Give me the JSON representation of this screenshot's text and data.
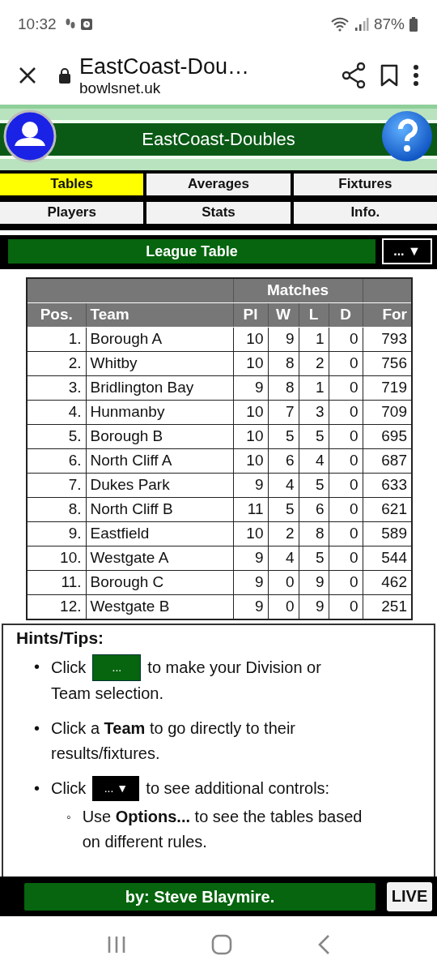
{
  "status_bar": {
    "time": "10:32",
    "battery": "87%"
  },
  "browser": {
    "title": "EastCoast-Dou…",
    "url": "bowlsnet.uk"
  },
  "header": {
    "title": "EastCoast-Doubles"
  },
  "tabs": [
    {
      "label": "Tables",
      "selected": true
    },
    {
      "label": "Averages",
      "selected": false
    },
    {
      "label": "Fixtures",
      "selected": false
    },
    {
      "label": "Players",
      "selected": false
    },
    {
      "label": "Stats",
      "selected": false
    },
    {
      "label": "Info.",
      "selected": false
    }
  ],
  "section": {
    "title": "League Table",
    "menu": "... ▼"
  },
  "table": {
    "group_heading": "Matches",
    "columns": [
      "Pos.",
      "Team",
      "Pl",
      "W",
      "L",
      "D",
      "For"
    ],
    "rows": [
      [
        "1.",
        "Borough A",
        "10",
        "9",
        "1",
        "0",
        "793"
      ],
      [
        "2.",
        "Whitby",
        "10",
        "8",
        "2",
        "0",
        "756"
      ],
      [
        "3.",
        "Bridlington Bay",
        "9",
        "8",
        "1",
        "0",
        "719"
      ],
      [
        "4.",
        "Hunmanby",
        "10",
        "7",
        "3",
        "0",
        "709"
      ],
      [
        "5.",
        "Borough B",
        "10",
        "5",
        "5",
        "0",
        "695"
      ],
      [
        "6.",
        "North Cliff A",
        "10",
        "6",
        "4",
        "0",
        "687"
      ],
      [
        "7.",
        "Dukes Park",
        "9",
        "4",
        "5",
        "0",
        "633"
      ],
      [
        "8.",
        "North Cliff B",
        "11",
        "5",
        "6",
        "0",
        "621"
      ],
      [
        "9.",
        "Eastfield",
        "10",
        "2",
        "8",
        "0",
        "589"
      ],
      [
        "10.",
        "Westgate A",
        "9",
        "4",
        "5",
        "0",
        "544"
      ],
      [
        "11.",
        "Borough C",
        "9",
        "0",
        "9",
        "0",
        "462"
      ],
      [
        "12.",
        "Westgate B",
        "9",
        "0",
        "9",
        "0",
        "251"
      ]
    ]
  },
  "hints": {
    "title": "Hints/Tips:",
    "items": [
      {
        "kind": "green-chip",
        "bullet": "•",
        "before": "Click",
        "chip": "...",
        "after_lines": [
          "to make your Division or",
          "Team selection."
        ]
      },
      {
        "kind": "text",
        "bullet": "•",
        "text": "Click a **Team** to go directly to their results/fixtures."
      },
      {
        "kind": "black-chip",
        "bullet": "•",
        "before": "Click",
        "chip": "... ▼",
        "after_lines": [
          "to see additional controls:"
        ],
        "children": [
          {
            "kind": "text",
            "bullet": "◦",
            "text": "Use **Options...** to see the tables based on different rules."
          }
        ]
      }
    ]
  },
  "footer": {
    "credit": "by: Steve Blaymire.",
    "live": "LIVE"
  }
}
